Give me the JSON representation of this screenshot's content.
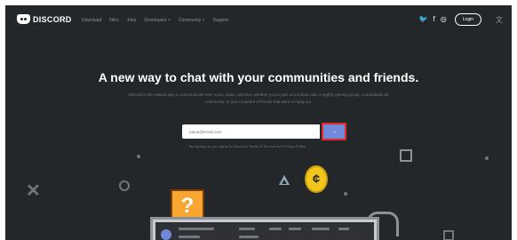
{
  "brand": {
    "name": "DISCORD"
  },
  "nav": {
    "links": [
      "Download",
      "Nitro",
      "Jobs",
      "Developers ˅",
      "Community ˅",
      "Support"
    ],
    "social_icons": [
      "twitter-icon",
      "facebook-icon",
      "instagram-icon"
    ],
    "social_glyphs": [
      "🐦",
      "f",
      "◎"
    ],
    "login_label": "Login",
    "language_glyph": "文"
  },
  "hero": {
    "headline": "A new way to chat with your communities and friends.",
    "subtext": "Discord is the easiest way to communicate over voice, video, and text, whether you’re part of a school club, a nightly gaming group, a worldwide art community, or just a handful of friends that want to hang out."
  },
  "signup": {
    "email_placeholder": "name@email.com",
    "submit_glyph": "→",
    "fine_print": "By signing up, you agree to Discord’s Terms of Service and Privacy Policy."
  },
  "decor": {
    "question_glyph": "?",
    "coin_glyph": "¢",
    "x_glyph": "✕"
  },
  "colors": {
    "background": "#23272a",
    "blurple": "#7289da",
    "highlight": "#e02a2a",
    "coin": "#f3c61d",
    "qblock": "#f8a532"
  }
}
